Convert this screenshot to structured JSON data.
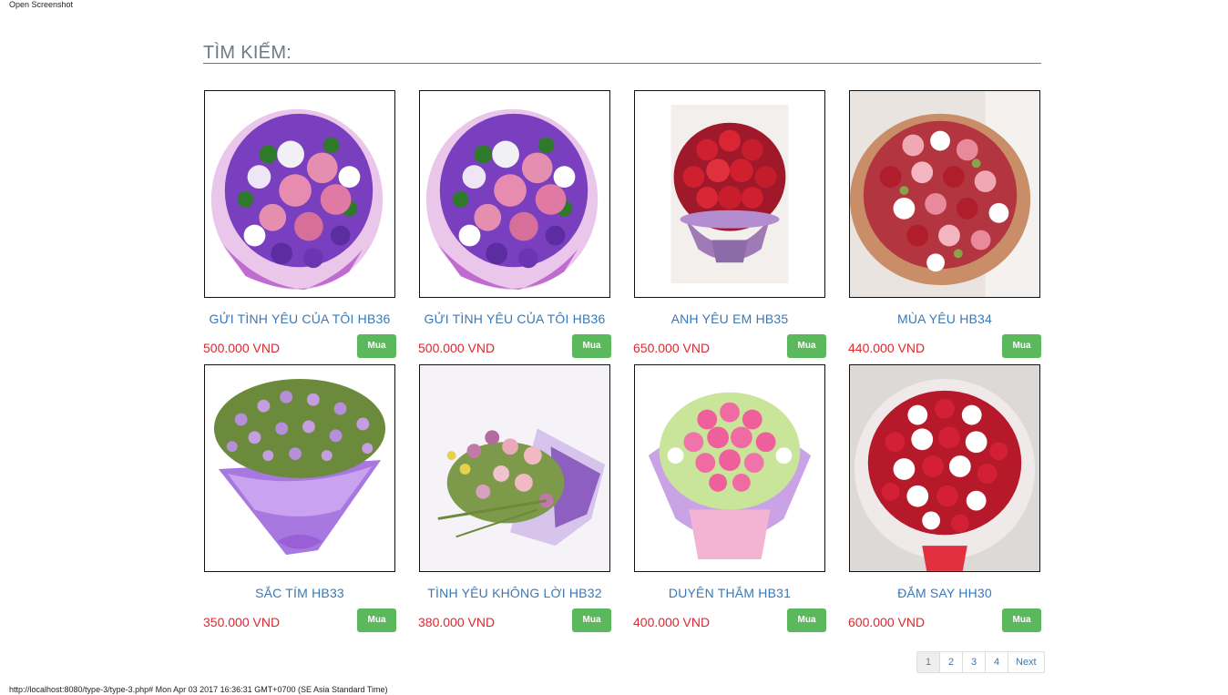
{
  "browser": {
    "open_screenshot_label": "Open Screenshot",
    "status_line": "http://localhost:8080/type-3/type-3.php# Mon Apr 03 2017 16:36:31 GMT+0700 (SE Asia Standard Time)"
  },
  "search": {
    "title": "TÌM KIẾM:"
  },
  "products": [
    {
      "name": "GỬI TÌNH YÊU CỦA TÔI HB36",
      "price": "500.000 VND",
      "buy_label": "Mua",
      "image": "purple-pink-rose-bouquet"
    },
    {
      "name": "GỬI TÌNH YÊU CỦA TÔI HB36",
      "price": "500.000 VND",
      "buy_label": "Mua",
      "image": "purple-pink-rose-bouquet"
    },
    {
      "name": "ANH YÊU EM HB35",
      "price": "650.000 VND",
      "buy_label": "Mua",
      "image": "red-rose-bouquet"
    },
    {
      "name": "MÙA YÊU HB34",
      "price": "440.000 VND",
      "buy_label": "Mua",
      "image": "mixed-rose-bouquet"
    },
    {
      "name": "SẮC TÍM HB33",
      "price": "350.000 VND",
      "buy_label": "Mua",
      "image": "purple-daisy-bouquet"
    },
    {
      "name": "TÌNH YÊU KHÔNG LỜI HB32",
      "price": "380.000 VND",
      "buy_label": "Mua",
      "image": "pastel-bouquet"
    },
    {
      "name": "DUYÊN THẮM HB31",
      "price": "400.000 VND",
      "buy_label": "Mua",
      "image": "pink-rose-bouquet"
    },
    {
      "name": "ĐẮM SAY HH30",
      "price": "600.000 VND",
      "buy_label": "Mua",
      "image": "red-white-rose-bouquet"
    }
  ],
  "pagination": {
    "pages": [
      "1",
      "2",
      "3",
      "4"
    ],
    "active": "1",
    "next_label": "Next"
  },
  "colors": {
    "title": "#6b7a87",
    "product_name": "#3a78b5",
    "price": "#e0262e",
    "buy_button": "#5cb85c"
  }
}
